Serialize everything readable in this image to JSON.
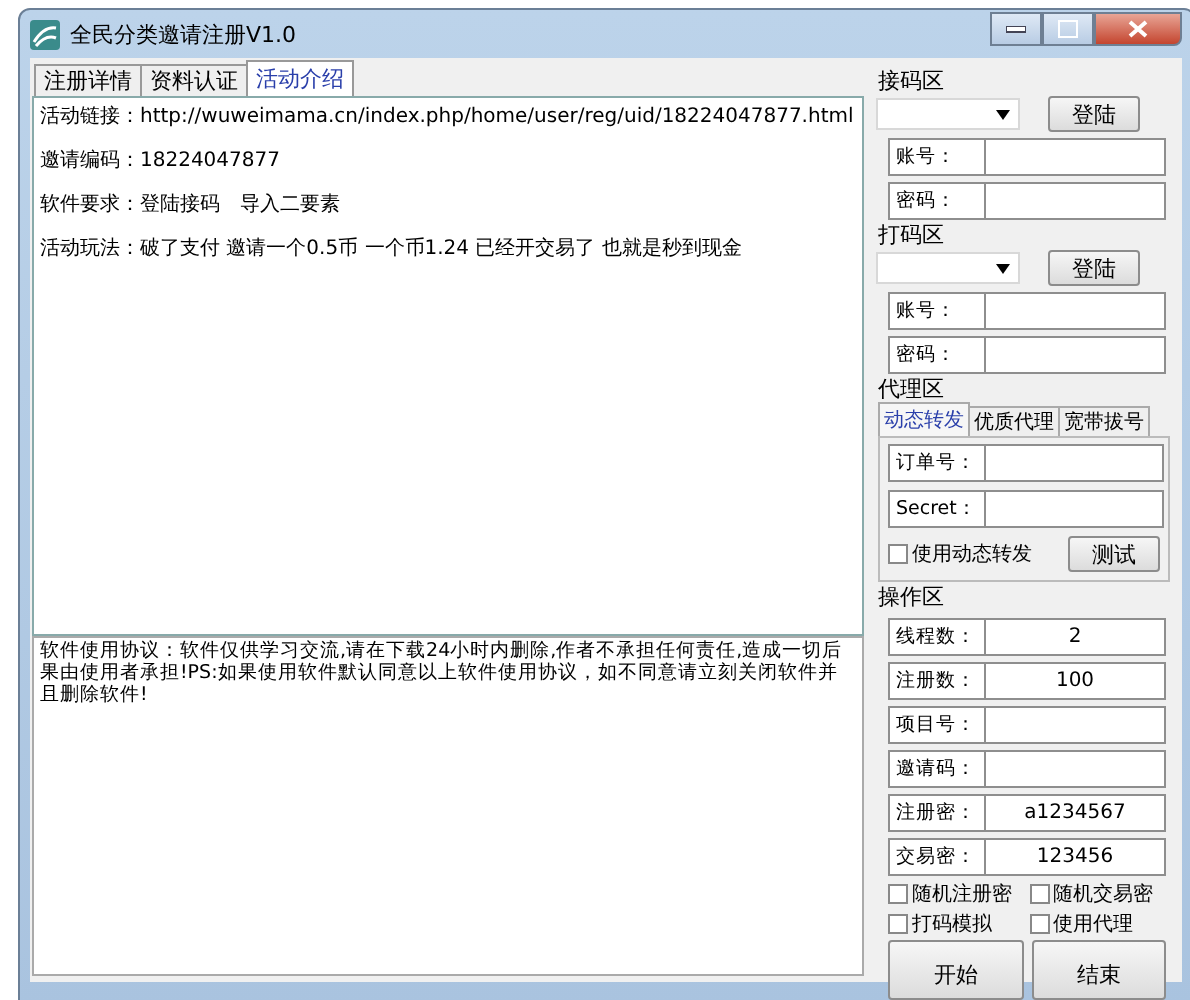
{
  "window": {
    "title": "全民分类邀请注册V1.0"
  },
  "tabs": [
    {
      "label": "注册详情",
      "selected": false
    },
    {
      "label": "资料认证",
      "selected": false
    },
    {
      "label": "活动介绍",
      "selected": true
    }
  ],
  "info_lines": [
    "活动链接：http://wuweimama.cn/index.php/home/user/reg/uid/18224047877.html",
    "邀请编码：18224047877",
    "软件要求：登陆接码　导入二要素",
    "活动玩法：破了支付 邀请一个0.5币 一个币1.24 已经开交易了 也就是秒到现金"
  ],
  "agreement": "软件使用协议：软件仅供学习交流,请在下载24小时内删除,作者不承担任何责任,造成一切后果由使用者承担!PS:如果使用软件默认同意以上软件使用协议，如不同意请立刻关闭软件并且删除软件!",
  "receive_section": {
    "title": "接码区",
    "login_button": "登陆",
    "fields": [
      {
        "label": "账号："
      },
      {
        "label": "密码："
      }
    ]
  },
  "captcha_section": {
    "title": "打码区",
    "login_button": "登陆",
    "fields": [
      {
        "label": "账号："
      },
      {
        "label": "密码："
      }
    ]
  },
  "proxy_section": {
    "title": "代理区",
    "tabs": [
      {
        "label": "动态转发",
        "selected": true
      },
      {
        "label": "优质代理",
        "selected": false
      },
      {
        "label": "宽带拔号",
        "selected": false
      }
    ],
    "fields": [
      {
        "label": "订单号："
      },
      {
        "label": "Secret："
      }
    ],
    "checkbox": {
      "label": "使用动态转发",
      "checked": false
    },
    "test_button": "测试"
  },
  "operation_section": {
    "title": "操作区",
    "fields": [
      {
        "label": "线程数：",
        "value": "2"
      },
      {
        "label": "注册数：",
        "value": "100"
      },
      {
        "label": "项目号："
      },
      {
        "label": "邀请码："
      },
      {
        "label": "注册密：",
        "value": "a1234567"
      },
      {
        "label": "交易密：",
        "value": "123456"
      }
    ],
    "checkboxes": [
      {
        "label": "随机注册密",
        "checked": false
      },
      {
        "label": "随机交易密",
        "checked": false
      },
      {
        "label": "打码模拟",
        "checked": false
      },
      {
        "label": "使用代理",
        "checked": false
      }
    ],
    "buttons": [
      "开始",
      "结束"
    ]
  }
}
